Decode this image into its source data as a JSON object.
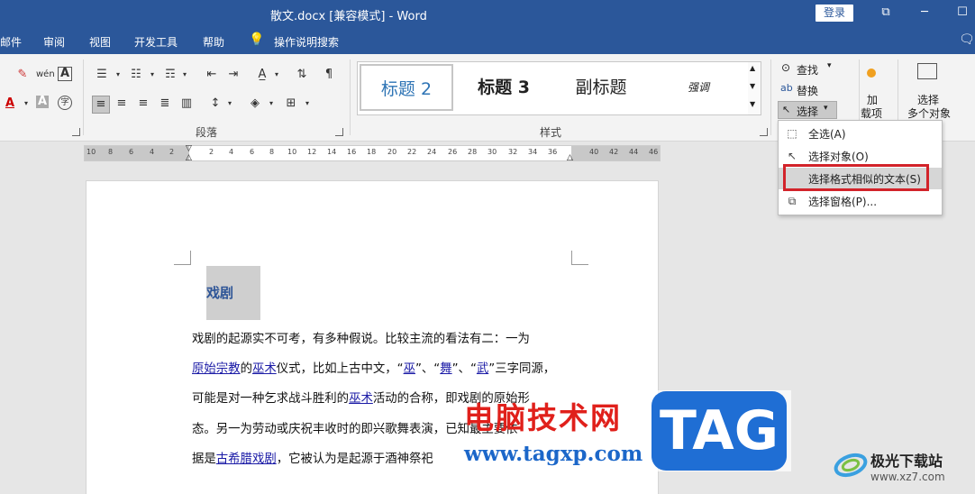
{
  "window": {
    "title": "散文.docx [兼容模式] - Word",
    "login_label": "登录"
  },
  "menu": {
    "items": [
      "邮件",
      "审阅",
      "视图",
      "开发工具",
      "帮助"
    ],
    "search_label": "操作说明搜索"
  },
  "ribbon": {
    "paragraph_group_label": "段落",
    "styles_group_label": "样式",
    "styles": [
      "标题 2",
      "标题 3",
      "副标题",
      "强调"
    ],
    "editing": {
      "find_label": "查找",
      "replace_label": "替换",
      "select_label": "选择"
    },
    "addin_label": "加\n载项",
    "addin_label_line1": "加",
    "addin_label_line2": "载项",
    "select_multi_line1": "选择",
    "select_multi_line2": "多个对象"
  },
  "ruler": {
    "left_numbers": [
      "10",
      "8",
      "6",
      "4",
      "2"
    ],
    "right_numbers": [
      "2",
      "4",
      "6",
      "8",
      "10",
      "12",
      "14",
      "16",
      "18",
      "20",
      "22",
      "24",
      "26",
      "28",
      "30",
      "32",
      "34",
      "36",
      "40",
      "42",
      "44",
      "46"
    ]
  },
  "dropdown": {
    "items": [
      {
        "label": "全选(A)",
        "icon": "select-all-icon"
      },
      {
        "label": "选择对象(O)",
        "icon": "pointer-icon"
      },
      {
        "label": "选择格式相似的文本(S)",
        "icon": "format-select-icon"
      },
      {
        "label": "选择窗格(P)...",
        "icon": "selection-pane-icon"
      }
    ]
  },
  "document": {
    "heading": "戏剧",
    "line1": "戏剧的起源实不可考，有多种假说。比较主流的看法有二：一为",
    "line2_link1": "原始宗教",
    "line2_t1": "的",
    "line2_link2": "巫术",
    "line2_t2": "仪式，比如上古中文，“",
    "line2_link3": "巫",
    "line2_t3": "”、“",
    "line2_link4": "舞",
    "line2_t4": "”、“",
    "line2_link5": "武",
    "line2_t5": "”三字同源，",
    "line3_t1": "可能是对一种乞求战斗胜利的",
    "line3_link": "巫术",
    "line3_t2": "活动的合称，即戏剧的原始形",
    "line4": "态。另一为劳动或庆祝丰收时的即兴歌舞表演，已知最主要依",
    "line5_t1": "据是",
    "line5_link": "古希腊戏剧",
    "line5_t2": "，它被认为是起源于酒神祭祀"
  },
  "watermark": {
    "cn": "电脑技术网",
    "url": "www.tagxp.com",
    "tag": "TAG",
    "brand": "极光下载站",
    "brand_url": "www.xz7.com"
  },
  "colors": {
    "title_bar": "#2b579a",
    "heading_text": "#2e5597",
    "highlight_box": "#d2232a"
  }
}
